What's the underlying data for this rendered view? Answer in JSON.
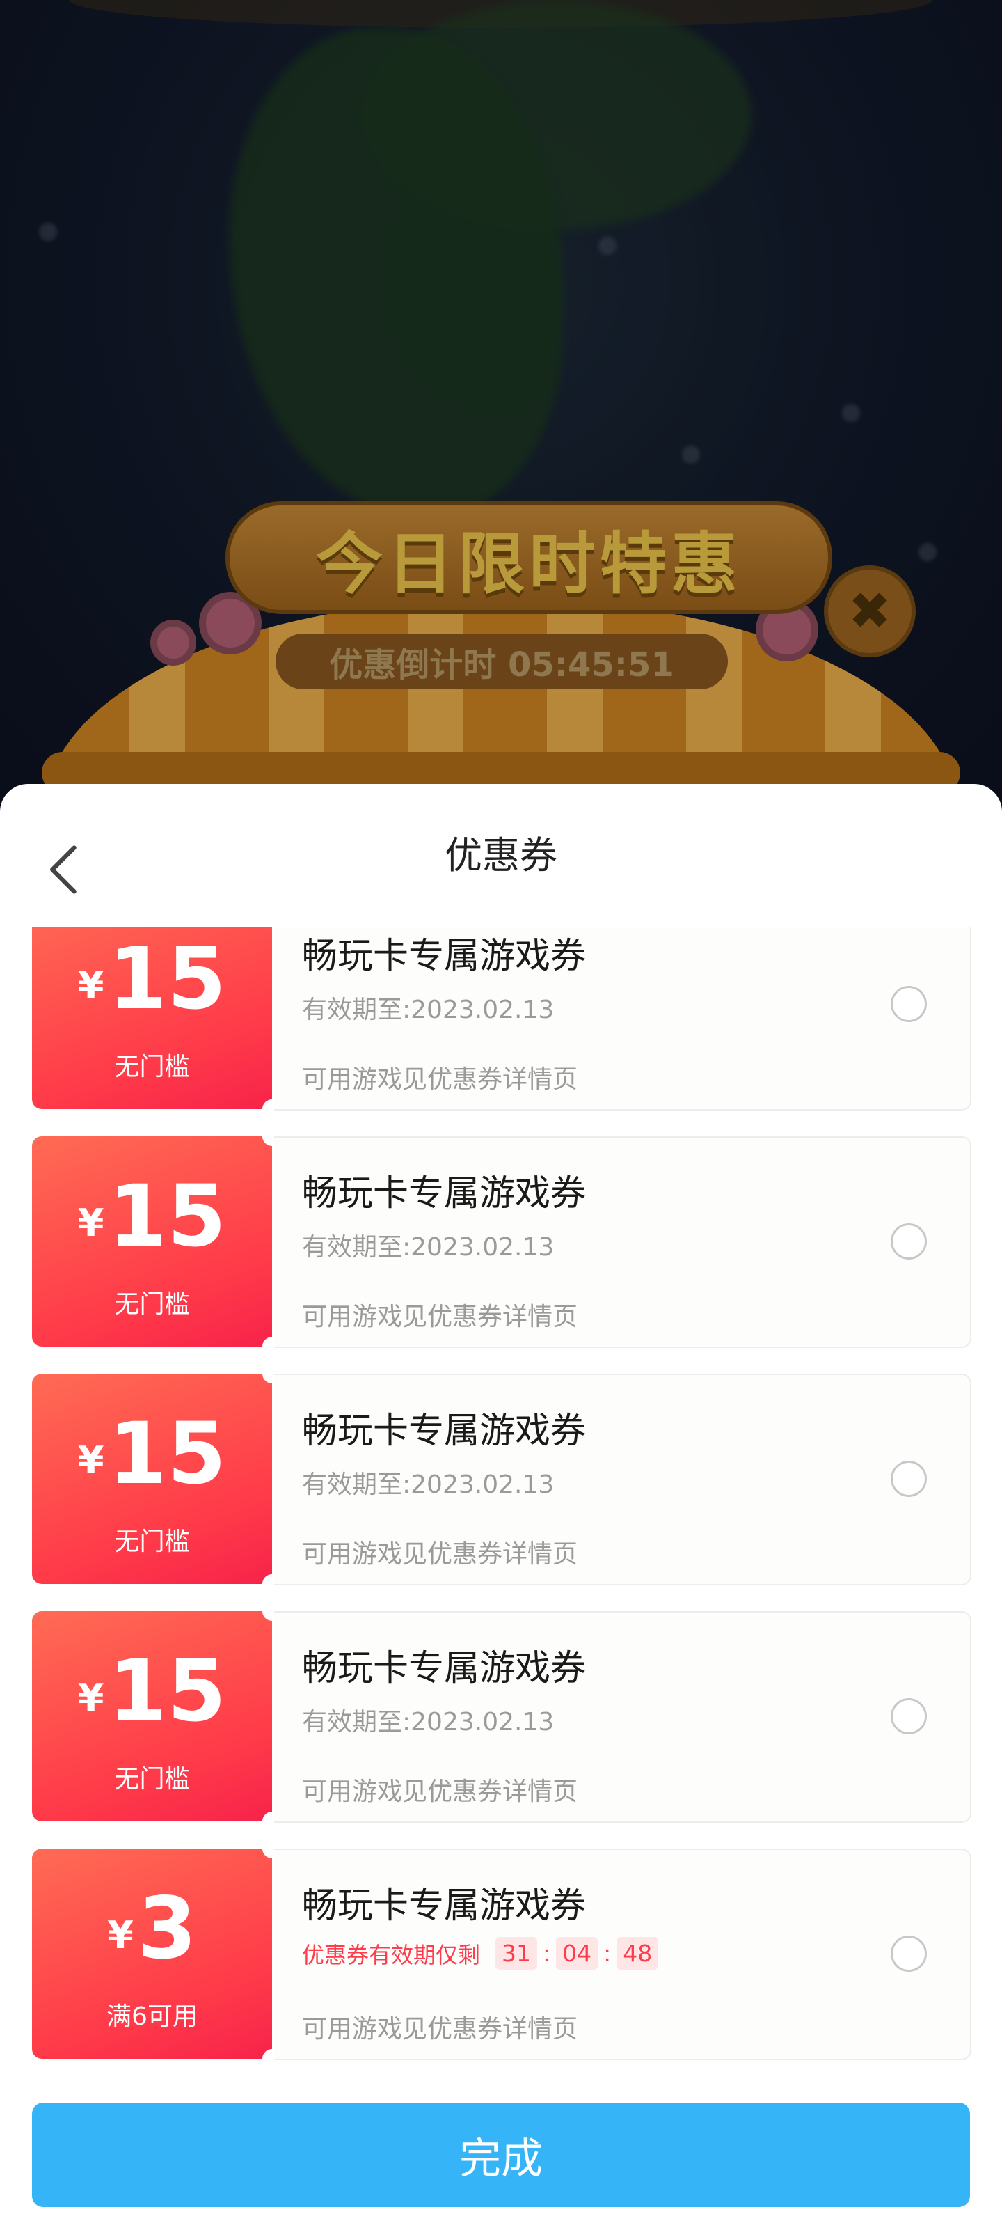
{
  "banner": {
    "title": "今日限时特惠",
    "countdown": "优惠倒计时 05:45:51",
    "close_glyph": "✖"
  },
  "sheet": {
    "back_icon": "chevron-left-icon",
    "title": "优惠券"
  },
  "coupons": [
    {
      "currency": "¥",
      "amount": "15",
      "threshold": "无门槛",
      "name": "畅玩卡专属游戏券",
      "expire": "有效期至:2023.02.13",
      "scope": "可用游戏见优惠券详情页"
    },
    {
      "currency": "¥",
      "amount": "15",
      "threshold": "无门槛",
      "name": "畅玩卡专属游戏券",
      "expire": "有效期至:2023.02.13",
      "scope": "可用游戏见优惠券详情页"
    },
    {
      "currency": "¥",
      "amount": "15",
      "threshold": "无门槛",
      "name": "畅玩卡专属游戏券",
      "expire": "有效期至:2023.02.13",
      "scope": "可用游戏见优惠券详情页"
    },
    {
      "currency": "¥",
      "amount": "15",
      "threshold": "无门槛",
      "name": "畅玩卡专属游戏券",
      "expire": "有效期至:2023.02.13",
      "scope": "可用游戏见优惠券详情页"
    },
    {
      "currency": "¥",
      "amount": "3",
      "threshold": "满6可用",
      "name": "畅玩卡专属游戏券",
      "expire_label": "优惠券有效期仅剩",
      "timer": [
        "31",
        "04",
        "48"
      ],
      "scope": "可用游戏见优惠券详情页"
    }
  ],
  "done_button": "完成",
  "colors": {
    "coupon_red": "#ff3a49",
    "button_blue": "#35b5f7",
    "timer_red": "#ff3b4c"
  }
}
